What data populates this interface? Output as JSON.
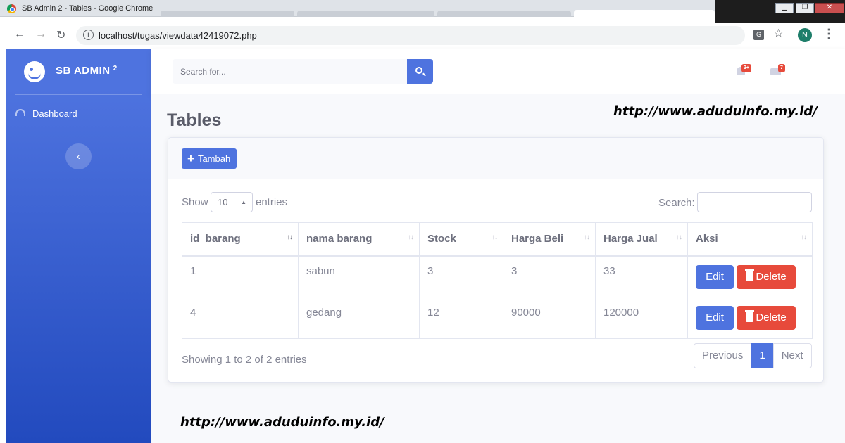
{
  "window": {
    "title": "SB Admin 2 - Tables - Google Chrome"
  },
  "browser": {
    "url": "localhost/tugas/viewdata42419072.php",
    "profile_initial": "N"
  },
  "sidebar": {
    "brand": "SB ADMIN",
    "brand_sup": "2",
    "items": [
      {
        "label": "Dashboard",
        "icon": "tachometer-icon"
      }
    ],
    "toggle_icon": "‹"
  },
  "topbar": {
    "search_placeholder": "Search for...",
    "alerts_badge": "3+",
    "messages_badge": "7"
  },
  "page": {
    "title": "Tables",
    "watermark": "http://www.aduduinfo.my.id/",
    "add_button": "Tambah"
  },
  "datatable": {
    "show_label": "Show",
    "entries_label": "entries",
    "page_length": "10",
    "search_label": "Search:",
    "columns": [
      "id_barang",
      "nama barang",
      "Stock",
      "Harga Beli",
      "Harga Jual",
      "Aksi"
    ],
    "rows": [
      {
        "id": "1",
        "nama": "sabun",
        "stock": "3",
        "beli": "3",
        "jual": "33"
      },
      {
        "id": "4",
        "nama": "gedang",
        "stock": "12",
        "beli": "90000",
        "jual": "120000"
      }
    ],
    "edit_label": "Edit",
    "delete_label": "Delete",
    "info": "Showing 1 to 2 of 2 entries",
    "pagination": {
      "previous": "Previous",
      "current": "1",
      "next": "Next"
    }
  },
  "colors": {
    "primary": "#4e73df",
    "danger": "#e74a3b",
    "sidebar_end": "#224abe",
    "text_muted": "#858796"
  }
}
